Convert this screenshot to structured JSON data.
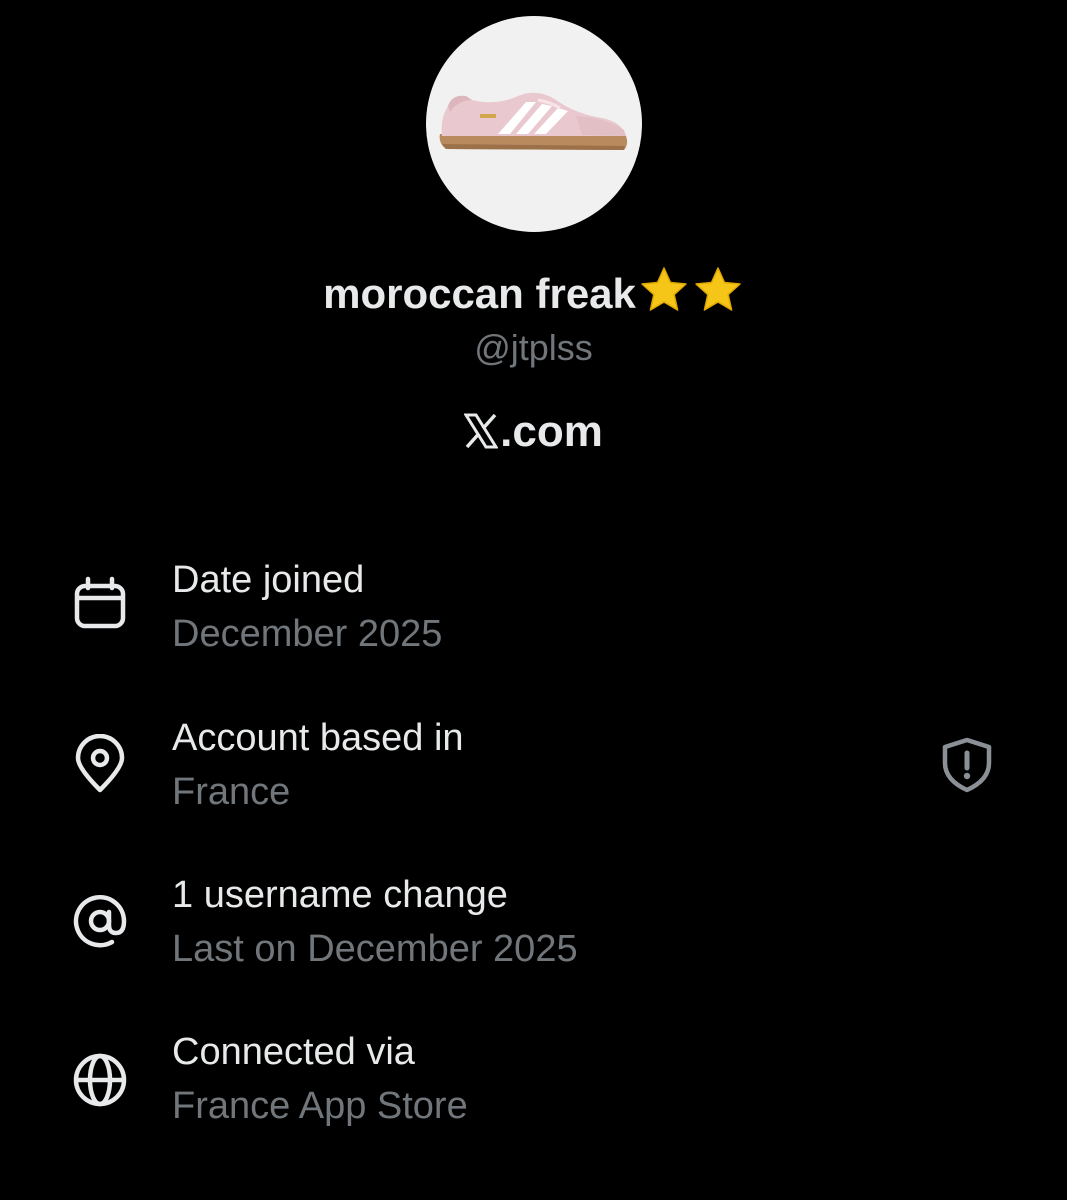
{
  "profile": {
    "display_name": "moroccan freak",
    "name_emoji": [
      "star-emoji",
      "star-emoji"
    ],
    "handle": "@jtplss",
    "avatar_subject": "pink suede sneaker with gum sole",
    "platform": ".com",
    "platform_logo": "x-logo"
  },
  "info": [
    {
      "icon": "calendar-icon",
      "title": "Date joined",
      "value": "December 2025"
    },
    {
      "icon": "location-pin-icon",
      "title": "Account based in",
      "value": "France",
      "side_icon": "shield-alert-icon"
    },
    {
      "icon": "at-sign-icon",
      "title": "1 username change",
      "value": "Last on December 2025"
    },
    {
      "icon": "globe-icon",
      "title": "Connected via",
      "value": "France App Store"
    }
  ],
  "colors": {
    "background": "#000000",
    "primary_text": "#e7e9ea",
    "secondary_text": "#71767b",
    "avatar_bg": "#f1f1f1",
    "star": "#f5c518"
  }
}
